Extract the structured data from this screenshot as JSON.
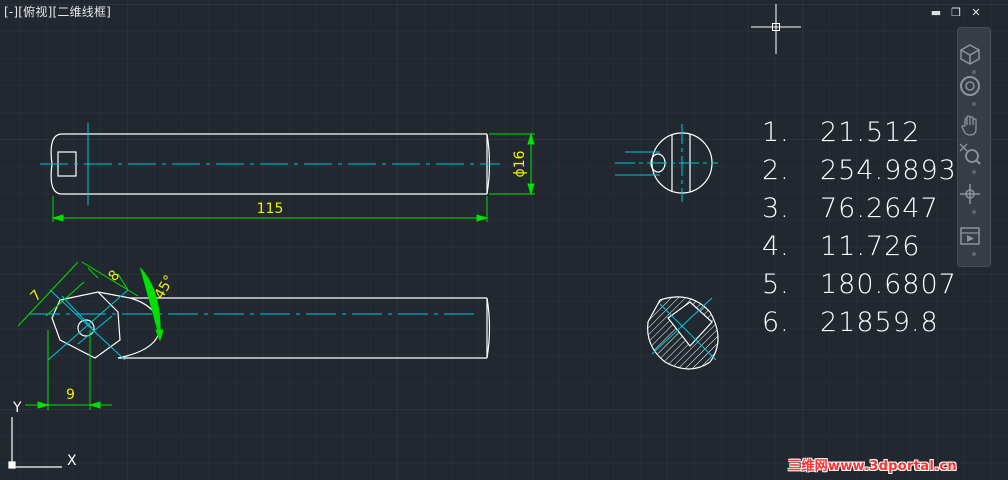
{
  "viewport": {
    "label": "[-][俯视][二维线框]"
  },
  "window_controls": {
    "minimize": "▬",
    "restore": "❐",
    "close": "✕"
  },
  "dimensions": {
    "length_top": "115",
    "diameter": "ϕ16",
    "chamfer_7": "7",
    "chamfer_8": "8",
    "angle": "45°",
    "offset_9": "9"
  },
  "ucs": {
    "x_label": "X",
    "y_label": "Y"
  },
  "results": [
    {
      "num": "1.",
      "value": "21.512"
    },
    {
      "num": "2.",
      "value": "254.9893"
    },
    {
      "num": "3.",
      "value": "76.2647"
    },
    {
      "num": "4.",
      "value": "11.726"
    },
    {
      "num": "5.",
      "value": "180.6807"
    },
    {
      "num": "6.",
      "value": "21859.8"
    }
  ],
  "navbar": {
    "items": [
      "viewcube-icon",
      "steering-wheel-icon",
      "pan-icon",
      "zoom-icon",
      "orbit-icon",
      "showmotion-icon"
    ]
  },
  "watermark": "三维网www.3dportal.cn",
  "colors": {
    "background": "#212830",
    "grid": "#2c3440",
    "object": "#ffffff",
    "centerline": "#00c8d8",
    "dimension": "#00e000",
    "dim_text": "#f0f000"
  }
}
